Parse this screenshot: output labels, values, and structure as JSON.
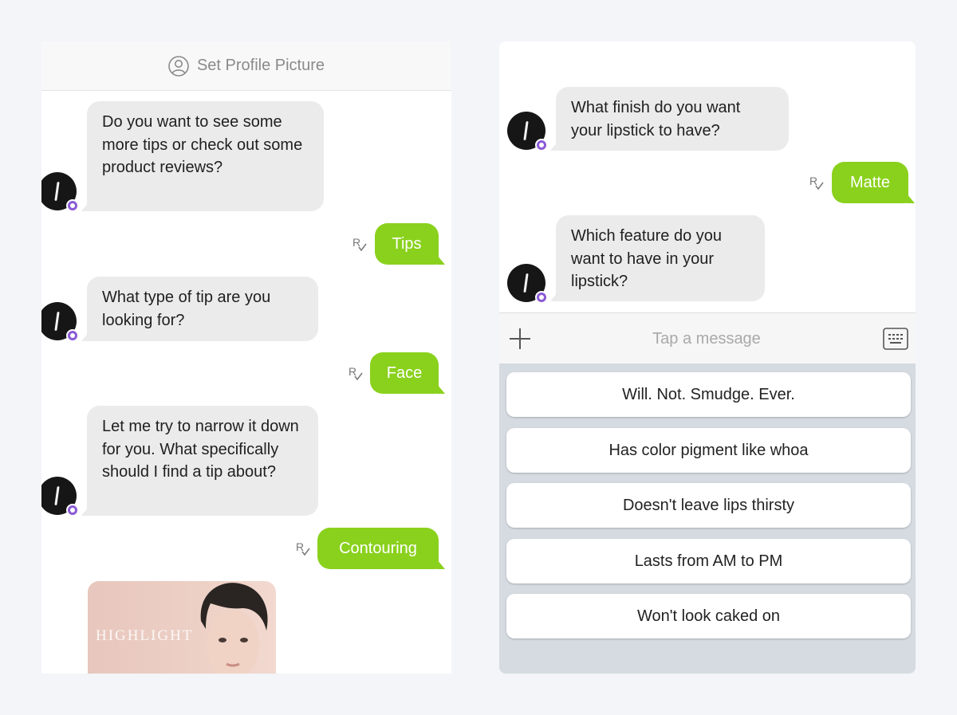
{
  "left_chat": {
    "profile_bar_label": "Set Profile Picture",
    "messages": [
      {
        "from": "bot",
        "text": "Do you want to see some more tips or check out some product reviews?"
      },
      {
        "from": "user",
        "text": "Tips"
      },
      {
        "from": "bot",
        "text": "What type of tip are you looking for?"
      },
      {
        "from": "user",
        "text": "Face"
      },
      {
        "from": "bot",
        "text": "Let me try to narrow it down for you. What specifically should I find a tip about?"
      },
      {
        "from": "user",
        "text": "Contouring"
      }
    ],
    "promo_card_text": "HIGHLIGHT"
  },
  "right_chat": {
    "messages": [
      {
        "from": "bot",
        "text": "What finish do you want your lipstick to have?"
      },
      {
        "from": "user",
        "text": "Matte"
      },
      {
        "from": "bot",
        "text": "Which feature do you want to have in your lipstick?"
      }
    ],
    "composer": {
      "placeholder": "Tap a message"
    },
    "quick_replies": [
      "Will. Not. Smudge. Ever.",
      "Has color pigment like whoa",
      "Doesn't leave lips thirsty",
      "Lasts from AM to PM",
      "Won't look caked on"
    ]
  },
  "colors": {
    "user_bubble": "#8ad11d",
    "bot_bubble": "#ebebeb",
    "avatar": "#161616",
    "badge": "#8a5ad6",
    "quick_reply_tray": "#d5dbe1"
  },
  "icons": {
    "profile": "user-circle-icon",
    "read_receipt": "read-receipt-icon",
    "add": "plus-icon",
    "keyboard": "keyboard-icon"
  }
}
